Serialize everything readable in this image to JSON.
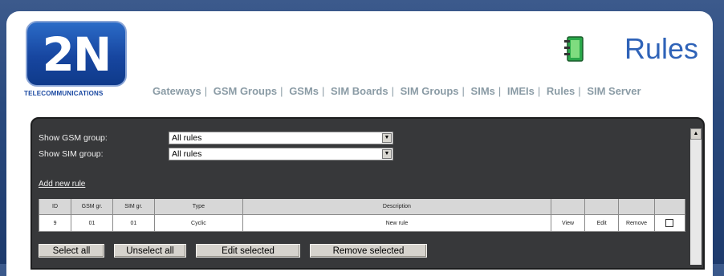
{
  "brand": {
    "logo_text": "2N",
    "logo_subtitle": "TELECOMMUNICATIONS"
  },
  "page": {
    "title": "Rules",
    "title_icon": "address-book-icon"
  },
  "nav": [
    {
      "label": "Gateways"
    },
    {
      "label": "GSM Groups"
    },
    {
      "label": "GSMs"
    },
    {
      "label": "SIM Boards"
    },
    {
      "label": "SIM Groups"
    },
    {
      "label": "SIMs"
    },
    {
      "label": "IMEIs"
    },
    {
      "label": "Rules"
    },
    {
      "label": "SIM Server"
    }
  ],
  "filters": {
    "gsm_group": {
      "label": "Show GSM group:",
      "value": "All rules"
    },
    "sim_group": {
      "label": "Show SIM group:",
      "value": "All rules"
    }
  },
  "add_link": "Add new rule",
  "table": {
    "headers": [
      "ID",
      "GSM gr.",
      "SIM gr.",
      "Type",
      "Description",
      "",
      "",
      "",
      ""
    ],
    "rows": [
      {
        "id": "9",
        "gsm": "01",
        "sim": "01",
        "type": "Cyclic",
        "description": "New rule",
        "view": "View",
        "edit": "Edit",
        "remove": "Remove"
      }
    ]
  },
  "buttons": {
    "select_all": "Select all",
    "unselect_all": "Unselect all",
    "edit_selected": "Edit selected",
    "remove_selected": "Remove selected"
  },
  "colors": {
    "accent": "#2f63b8",
    "panel": "#37383a",
    "nav": "#8a9ba5"
  }
}
